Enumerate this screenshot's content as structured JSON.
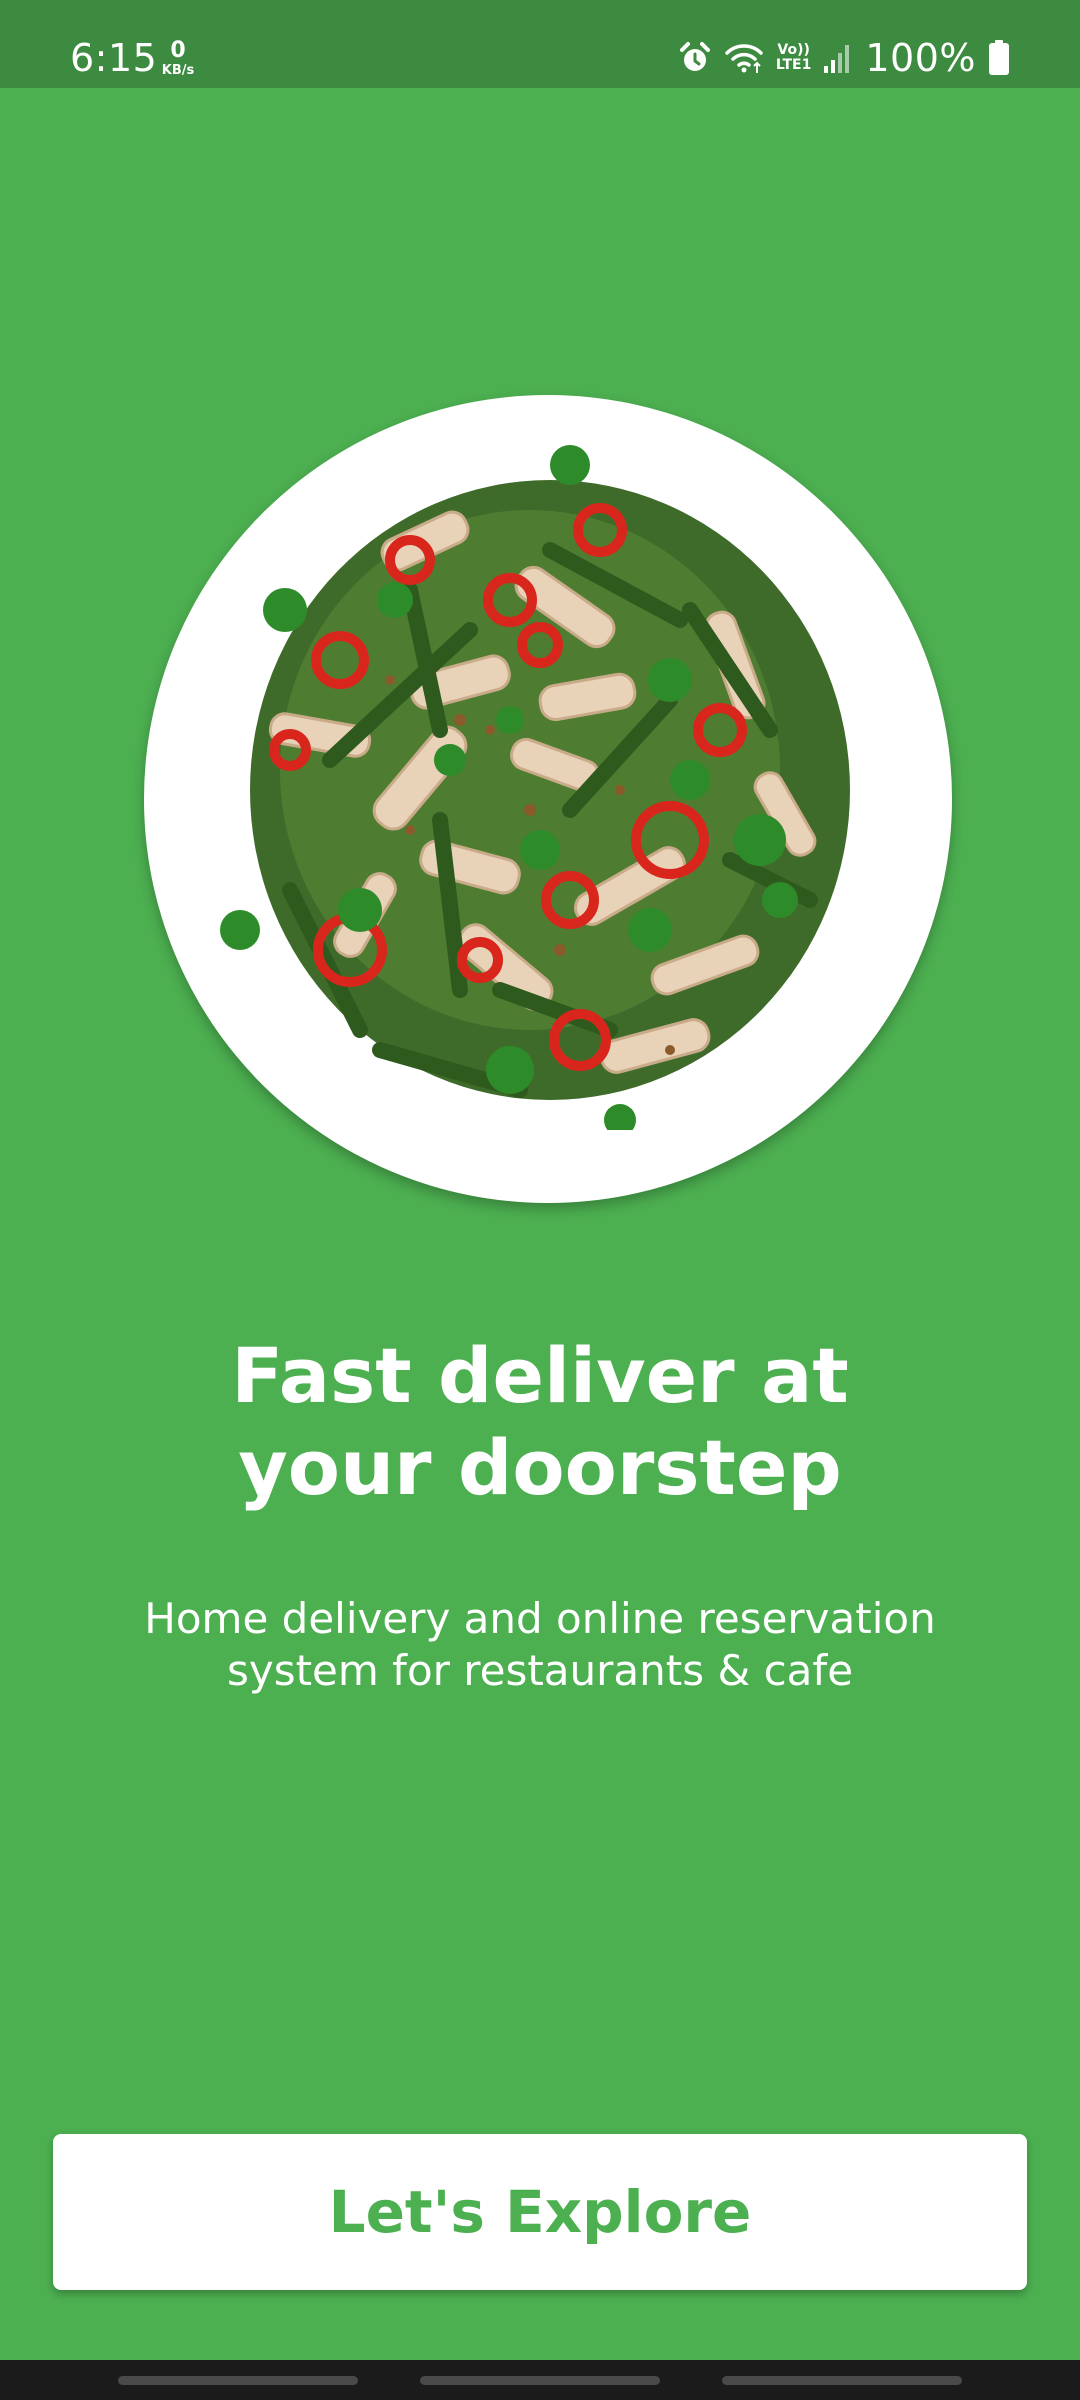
{
  "status_bar": {
    "time": "6:15",
    "net_speed_value": "0",
    "net_speed_unit": "KB/s",
    "lte_top": "Vo))",
    "lte_bottom": "LTE1",
    "battery": "100%"
  },
  "hero": {
    "image_icon": "salad-plate-image"
  },
  "onboarding": {
    "title_line1": "Fast deliver at",
    "title_line2": "your doorstep",
    "subtitle_line1": "Home delivery and online reservation",
    "subtitle_line2": "system for restaurants & cafe"
  },
  "cta": {
    "explore_label": "Let's Explore"
  },
  "colors": {
    "background": "#4caf50",
    "status_bar": "#3d8b40",
    "button_bg": "#ffffff",
    "button_text": "#4caf50"
  }
}
